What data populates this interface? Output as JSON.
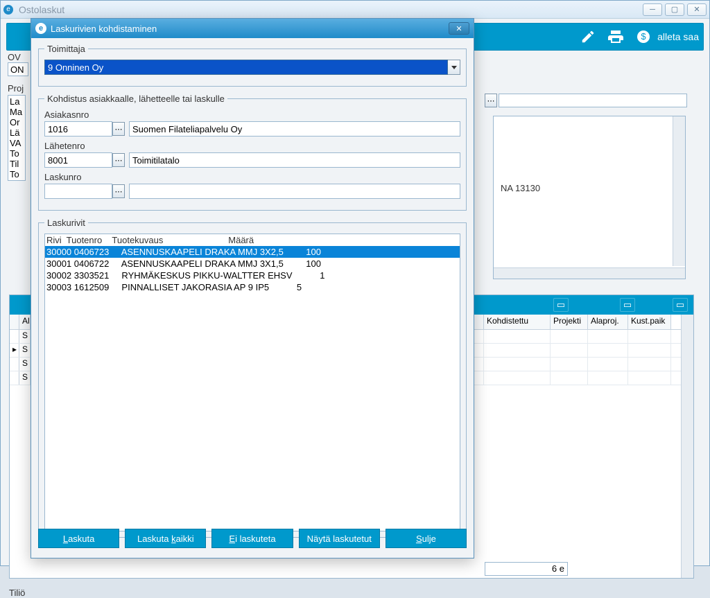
{
  "parent": {
    "title": "Ostolaskut",
    "toolbar": {
      "right_label": "alleta saa"
    },
    "left": {
      "ov_label": "OV",
      "ov_value": "ON",
      "proj_label": "Proj",
      "list_items": [
        "La",
        "Ma",
        "Or",
        "Lä",
        "VA",
        "To",
        "Til",
        "To"
      ]
    },
    "right": {
      "side_text": "NA 13130"
    },
    "grid": {
      "headers": [
        "Al",
        "S",
        "S",
        "S",
        "S"
      ],
      "columns": [
        "Kohdistettu",
        "Projekti",
        "Alaproj.",
        "Kust.paik"
      ]
    },
    "bottom": {
      "total_suffix": "6 e",
      "tilio_label": "Tiliö"
    }
  },
  "dialog": {
    "title": "Laskurivien kohdistaminen",
    "supplier": {
      "legend": "Toimittaja",
      "selected": "9 Onninen Oy"
    },
    "target": {
      "legend": "Kohdistus asiakkaalle, lähetteelle tai laskulle",
      "customer_no_label": "Asiakasnro",
      "customer_no": "1016",
      "customer_name": "Suomen Filateliapalvelu Oy",
      "delivery_no_label": "Lähetenro",
      "delivery_no": "8001",
      "delivery_name": "Toimitilatalo",
      "invoice_no_label": "Laskunro",
      "invoice_no": "",
      "invoice_name": ""
    },
    "rows": {
      "legend": "Laskurivit",
      "header": {
        "rivi": "Rivi",
        "tuotenro": "Tuotenro",
        "tuotekuvaus": "Tuotekuvaus",
        "maara": "Määrä"
      },
      "items": [
        {
          "rivi": "30000",
          "tuotenro": "0406723",
          "tuotekuvaus": "ASENNUSKAAPELI DRAKA MMJ 3X2,5",
          "maara": "100",
          "selected": true
        },
        {
          "rivi": "30001",
          "tuotenro": "0406722",
          "tuotekuvaus": "ASENNUSKAAPELI DRAKA MMJ 3X1,5",
          "maara": "100",
          "selected": false
        },
        {
          "rivi": "30002",
          "tuotenro": "3303521",
          "tuotekuvaus": "RYHMÄKESKUS PIKKU-WALTTER EHSV",
          "maara": "1",
          "selected": false
        },
        {
          "rivi": "30003",
          "tuotenro": "1612509",
          "tuotekuvaus": "PINNALLISET JAKORASIA AP 9 IP5",
          "maara": "5",
          "selected": false
        }
      ]
    },
    "buttons": {
      "laskuta": "Laskuta",
      "laskuta_kaikki": "Laskuta kaikki",
      "ei_laskuteta": "Ei laskuteta",
      "nayta_laskutetut": "Näytä laskutetut",
      "sulje": "Sulje"
    }
  }
}
